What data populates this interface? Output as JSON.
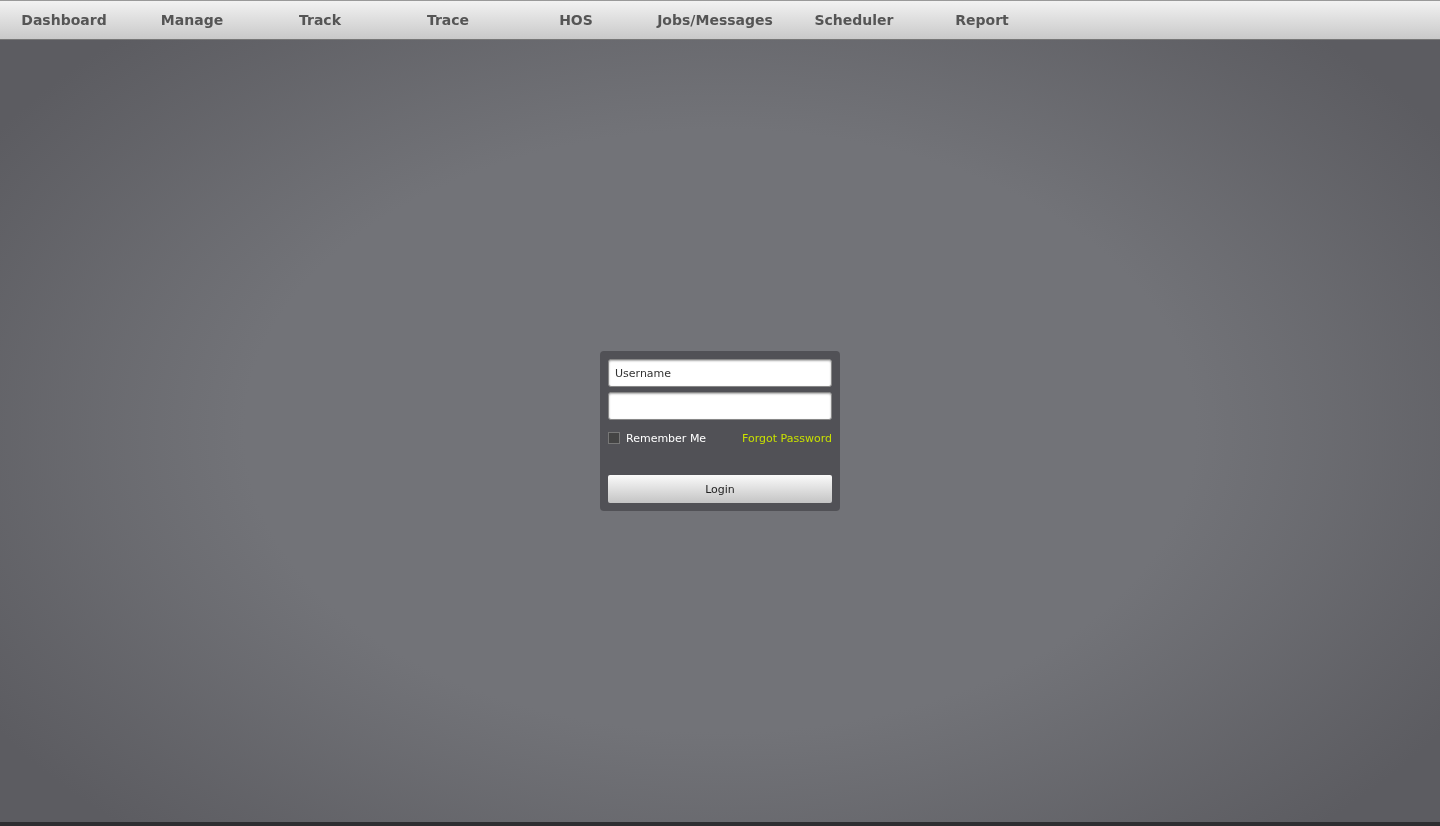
{
  "nav": {
    "items": [
      {
        "label": "Dashboard"
      },
      {
        "label": "Manage"
      },
      {
        "label": "Track"
      },
      {
        "label": "Trace"
      },
      {
        "label": "HOS"
      },
      {
        "label": "Jobs/Messages"
      },
      {
        "label": "Scheduler"
      },
      {
        "label": "Report"
      }
    ]
  },
  "login": {
    "username": {
      "placeholder": "Username"
    },
    "remember_me": {
      "label": "Remember Me",
      "checked": false
    },
    "forgot_password": "Forgot Password",
    "button": "Login"
  }
}
